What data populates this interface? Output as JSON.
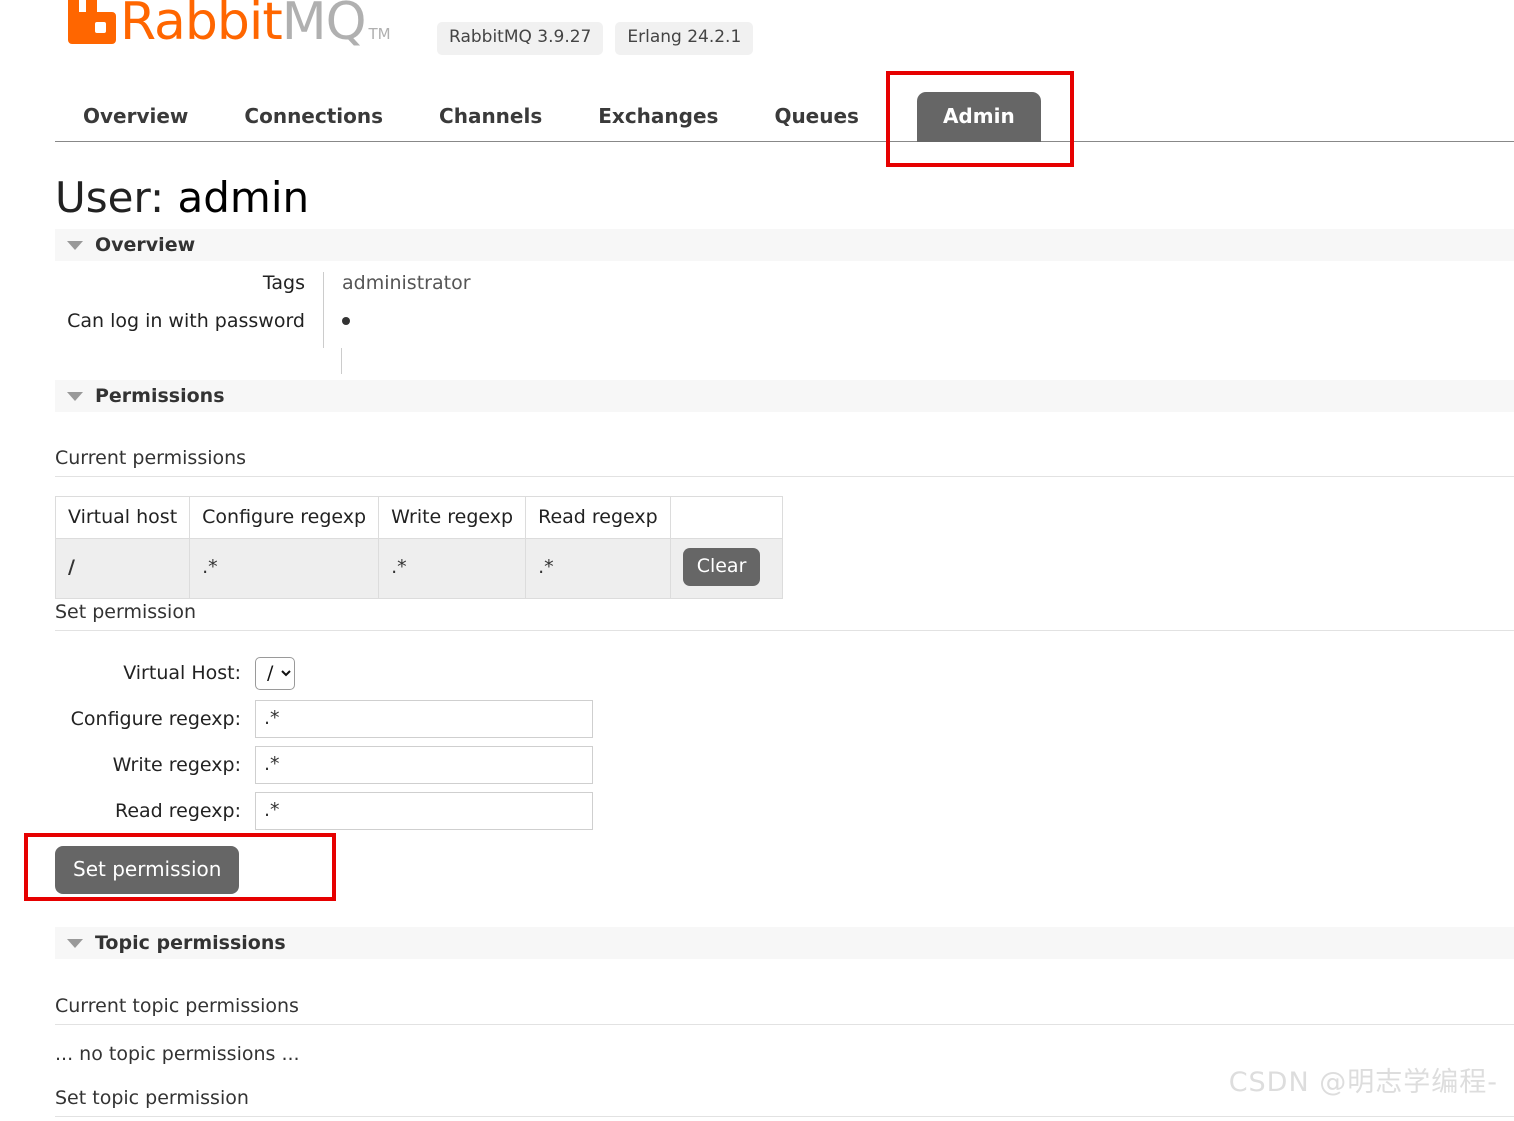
{
  "header": {
    "logo_rabbit": "Rabbit",
    "logo_mq": "MQ",
    "logo_tm": "TM",
    "badges": [
      {
        "label": "RabbitMQ 3.9.27"
      },
      {
        "label": "Erlang 24.2.1"
      }
    ]
  },
  "nav": {
    "items": [
      {
        "label": "Overview",
        "active": false
      },
      {
        "label": "Connections",
        "active": false
      },
      {
        "label": "Channels",
        "active": false
      },
      {
        "label": "Exchanges",
        "active": false
      },
      {
        "label": "Queues",
        "active": false
      },
      {
        "label": "Admin",
        "active": true
      }
    ]
  },
  "page": {
    "title_prefix": "User:",
    "title_name": "admin"
  },
  "overview": {
    "section_label": "Overview",
    "rows": [
      {
        "label": "Tags",
        "value": "administrator"
      },
      {
        "label": "Can log in with password",
        "value": "•"
      }
    ]
  },
  "permissions": {
    "section_label": "Permissions",
    "current_label": "Current permissions",
    "table": {
      "headers": [
        "Virtual host",
        "Configure regexp",
        "Write regexp",
        "Read regexp",
        ""
      ],
      "rows": [
        {
          "virtual_host": "/",
          "configure": ".*",
          "write": ".*",
          "read": ".*",
          "action_label": "Clear"
        }
      ]
    },
    "set_label": "Set permission",
    "form": {
      "vhost_label": "Virtual Host:",
      "vhost_value": "/",
      "vhost_options": [
        "/"
      ],
      "configure_label": "Configure regexp:",
      "configure_value": ".*",
      "write_label": "Write regexp:",
      "write_value": ".*",
      "read_label": "Read regexp:",
      "read_value": ".*",
      "submit_label": "Set permission"
    }
  },
  "topic_permissions": {
    "section_label": "Topic permissions",
    "current_label": "Current topic permissions",
    "empty_text": "... no topic permissions ...",
    "set_label": "Set topic permission"
  },
  "watermark": {
    "text": "CSDN @明志学编程-"
  },
  "colors": {
    "brand_orange": "#ff6600",
    "logo_gray": "#b0b0b0",
    "active_tab": "#666666",
    "annotation_red": "#e60000",
    "section_bar": "#f7f7f7"
  }
}
